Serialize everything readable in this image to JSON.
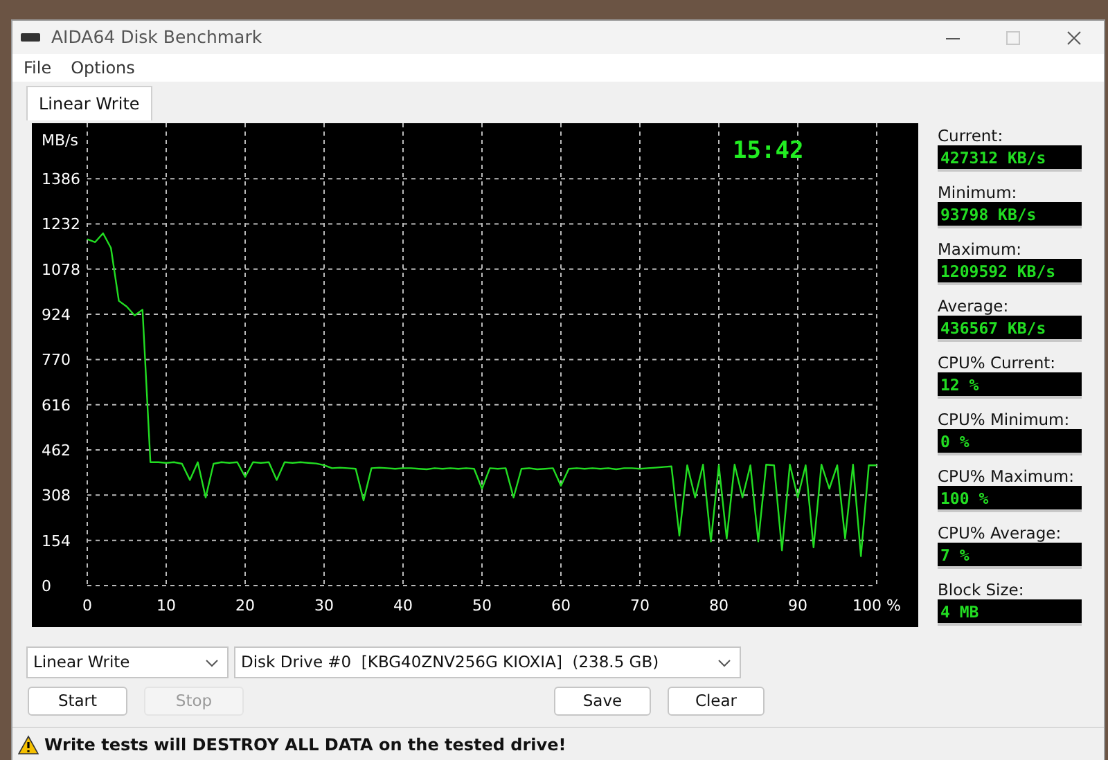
{
  "window": {
    "title": "AIDA64 Disk Benchmark"
  },
  "menu": [
    "File",
    "Options"
  ],
  "tabs": [
    {
      "label": "Linear Write",
      "selected": true
    }
  ],
  "chart": {
    "clock": "15:42",
    "chart_data": {
      "type": "line",
      "ylabel": "MB/s",
      "xlim": [
        0,
        100
      ],
      "ylim": [
        0,
        1575
      ],
      "grid": true,
      "yticks": [
        0,
        154,
        308,
        462,
        616,
        770,
        924,
        1078,
        1232,
        1386
      ],
      "xticks": [
        0,
        10,
        20,
        30,
        40,
        50,
        60,
        70,
        80,
        90,
        {
          "value": 100,
          "label": "100 %"
        }
      ],
      "x": [
        0,
        1,
        2,
        3,
        4,
        5,
        6,
        7,
        8,
        9,
        10,
        11,
        12,
        13,
        14,
        15,
        16,
        17,
        18,
        19,
        20,
        21,
        22,
        23,
        24,
        25,
        26,
        27,
        28,
        29,
        30,
        31,
        32,
        33,
        34,
        35,
        36,
        37,
        38,
        39,
        40,
        41,
        42,
        43,
        44,
        45,
        46,
        47,
        48,
        49,
        50,
        51,
        52,
        53,
        54,
        55,
        56,
        57,
        58,
        59,
        60,
        61,
        62,
        63,
        64,
        65,
        66,
        67,
        68,
        69,
        70,
        71,
        72,
        73,
        74,
        75,
        76,
        77,
        78,
        79,
        80,
        81,
        82,
        83,
        84,
        85,
        86,
        87,
        88,
        89,
        90,
        91,
        92,
        93,
        94,
        95,
        96,
        97,
        98,
        99,
        100
      ],
      "series": [
        {
          "color": "#22dd22",
          "values": [
            1180,
            1170,
            1200,
            1150,
            970,
            950,
            920,
            940,
            420,
            420,
            418,
            420,
            415,
            360,
            420,
            300,
            415,
            420,
            418,
            420,
            370,
            420,
            418,
            420,
            360,
            420,
            418,
            420,
            418,
            416,
            410,
            400,
            402,
            400,
            398,
            290,
            400,
            402,
            400,
            398,
            400,
            400,
            398,
            396,
            400,
            398,
            400,
            398,
            400,
            398,
            330,
            400,
            398,
            400,
            300,
            398,
            400,
            396,
            398,
            400,
            340,
            398,
            400,
            398,
            400,
            398,
            400,
            396,
            400,
            400,
            398,
            400,
            402,
            404,
            406,
            170,
            410,
            300,
            412,
            150,
            410,
            160,
            412,
            300,
            410,
            150,
            412,
            410,
            120,
            412,
            300,
            410,
            130,
            412,
            330,
            410,
            160,
            412,
            100,
            410,
            410
          ]
        }
      ]
    }
  },
  "stats": [
    {
      "label": "Current:",
      "value": "427312 KB/s"
    },
    {
      "label": "Minimum:",
      "value": "93798 KB/s"
    },
    {
      "label": "Maximum:",
      "value": "1209592 KB/s"
    },
    {
      "label": "Average:",
      "value": "436567 KB/s"
    },
    {
      "label": "CPU% Current:",
      "value": "12 %"
    },
    {
      "label": "CPU% Minimum:",
      "value": "0 %"
    },
    {
      "label": "CPU% Maximum:",
      "value": "100 %"
    },
    {
      "label": "CPU% Average:",
      "value": "7 %"
    },
    {
      "label": "Block Size:",
      "value": "4 MB"
    }
  ],
  "test_select": {
    "value": "Linear Write"
  },
  "drive_select": {
    "value": "Disk Drive #0  [KBG40ZNV256G KIOXIA]  (238.5 GB)"
  },
  "left_buttons": [
    {
      "label": "Start",
      "disabled": false
    },
    {
      "label": "Stop",
      "disabled": true
    }
  ],
  "right_buttons": [
    {
      "label": "Save",
      "disabled": false
    },
    {
      "label": "Clear",
      "disabled": false
    }
  ],
  "status_bar": {
    "text": "Write tests will DESTROY ALL DATA on the tested drive!"
  }
}
